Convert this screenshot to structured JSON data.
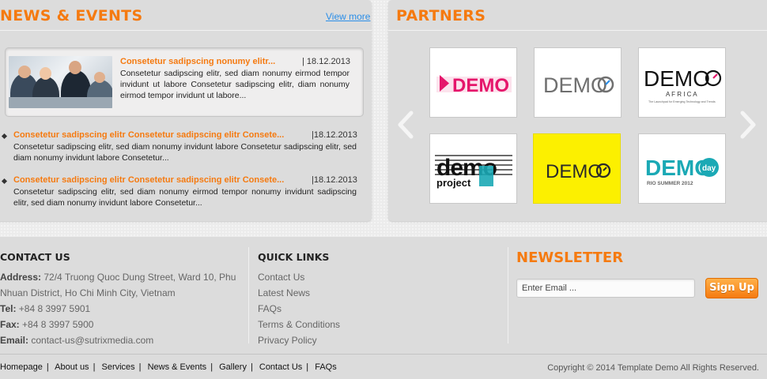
{
  "news": {
    "title": "NEWS & EVENTS",
    "view_more": "View more",
    "featured": {
      "title": "Consetetur sadipscing nonumy elitr...",
      "date": "| 18.12.2013",
      "body": "Consetetur sadipscing elitr, sed diam nonumy eirmod tempor invidunt ut labore Consetetur sadipscing elitr,  diam nonumy eirmod tempor invidunt ut labore..."
    },
    "items": [
      {
        "title": "Consetetur sadipscing elitr Consetetur sadipscing elitr Consete...",
        "date": "|18.12.2013",
        "body": "Consetetur sadipscing elitr, sed diam nonumy invidunt labore Consetetur sadipscing elitr, sed diam nonumy invidunt labore Consetetur..."
      },
      {
        "title": "Consetetur sadipscing elitr Consetetur sadipscing elitr Consete...",
        "date": "|18.12.2013",
        "body": "Consetetur sadipscing elitr, sed diam nonumy eirmod tempor nonumy invidunt sadipscing elitr, sed diam nonumy invidunt labore Consetetur..."
      }
    ]
  },
  "partners": {
    "title": "PARTNERS",
    "logos": [
      {
        "text": "DEMO",
        "style": "magenta-play"
      },
      {
        "text": "DEMO",
        "style": "gray-clock"
      },
      {
        "text": "DEMO",
        "sub": "A F R I C A",
        "tag": "The Launchpad for Emerging Technology and Trends",
        "style": "africa"
      },
      {
        "text": "demo",
        "sub": "project",
        "style": "project"
      },
      {
        "text": "DEMO",
        "style": "yellow-clock"
      },
      {
        "text": "DEMO",
        "badge": "day",
        "sub": "RIO SUMMER 2012",
        "style": "teal-day"
      }
    ]
  },
  "footer": {
    "contact": {
      "heading": "CONTACT US",
      "address_label": "Address:",
      "address_line1": "72/4 Truong Quoc Dung Street, Ward 10, Phu",
      "address_line2": "Nhuan District, Ho Chi Minh City, Vietnam",
      "tel_label": "Tel:",
      "tel": "+84 8 3997 5901",
      "fax_label": "Fax:",
      "fax": "+84 8 3997 5900",
      "email_label": "Email:",
      "email": "contact-us@sutrixmedia.com"
    },
    "quick_links": {
      "heading": "QUICK LINKS",
      "links": [
        "Contact Us",
        "Latest News",
        "FAQs",
        "Terms & Conditions",
        "Privacy Policy"
      ]
    },
    "newsletter": {
      "heading": "NEWSLETTER",
      "placeholder": "Enter Email ...",
      "button": "Sign Up"
    },
    "nav": [
      "Homepage",
      "About us",
      "Services",
      "News & Events",
      "Gallery",
      "Contact Us",
      "FAQs"
    ],
    "copyright": "Copyright © 2014 Template Demo All Rights Reserved."
  },
  "colors": {
    "accent": "#f57a10",
    "link": "#2a8ee8",
    "magenta": "#e5166b",
    "teal": "#1ba9b5",
    "yellow": "#fcf000"
  }
}
